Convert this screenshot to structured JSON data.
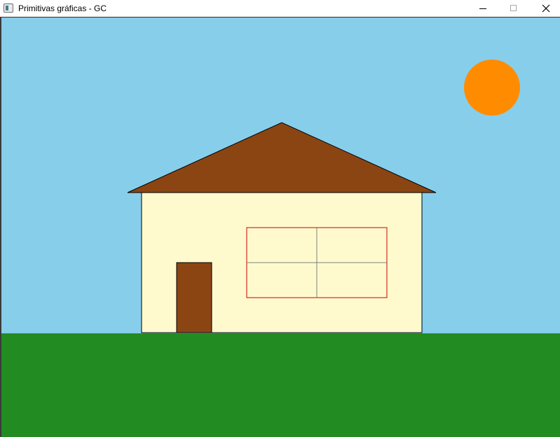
{
  "window": {
    "title": "Primitivas gráficas - GC",
    "icon": "app-window-icon",
    "controls": {
      "minimize_icon": "minimize-icon",
      "maximize_icon": "maximize-icon",
      "close_icon": "close-icon"
    }
  },
  "scene": {
    "colors": {
      "sky": "#87CEEB",
      "grass": "#228B22",
      "sun": "#FF8C00",
      "roof": "#8B4513",
      "wall": "#FFFACD",
      "door": "#8B4513",
      "window_frame": "#CC0000",
      "window_divider": "#808080",
      "outline": "#000000"
    }
  }
}
